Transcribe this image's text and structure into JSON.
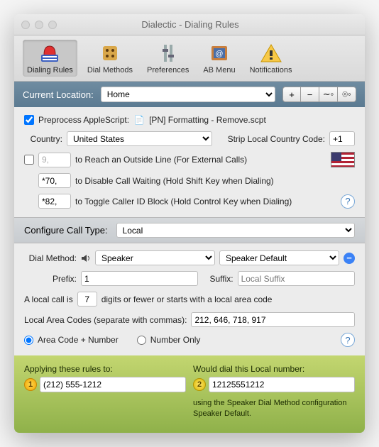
{
  "window": {
    "title": "Dialectic - Dialing Rules"
  },
  "toolbar": {
    "t0": "Dialing Rules",
    "t1": "Dial Methods",
    "t2": "Preferences",
    "t3": "AB Menu",
    "t4": "Notifications"
  },
  "location": {
    "label": "Current Location:",
    "value": "Home",
    "plus": "+",
    "minus": "−",
    "gear1": "∼◦",
    "gear2": "⌾◦"
  },
  "pre": {
    "checkLabel": "Preprocess AppleScript:",
    "script": "[PN] Formatting - Remove.scpt",
    "countryLabel": "Country:",
    "country": "United States",
    "stripLabel": "Strip Local Country Code:",
    "stripValue": "+1",
    "outsideValue": "9,",
    "outsideLabel": "to Reach an Outside Line (For External Calls)",
    "cwValue": "*70,",
    "cwLabel": "to Disable Call Waiting (Hold Shift Key when Dialing)",
    "cidValue": "*82,",
    "cidLabel": "to Toggle Caller ID Block (Hold Control Key when Dialing)"
  },
  "callType": {
    "label": "Configure Call Type:",
    "value": "Local"
  },
  "local": {
    "dmLabel": "Dial Method:",
    "dmValue": "Speaker",
    "dmSetting": "Speaker Default",
    "prefixLabel": "Prefix:",
    "prefixValue": "1",
    "suffixLabel": "Suffix:",
    "suffixPlaceholder": "Local Suffix",
    "sent1": "A local call is",
    "digits": "7",
    "sent2": "digits or fewer or starts with a local area code",
    "lacLabel": "Local Area Codes (separate with commas):",
    "lacValue": "212, 646, 718, 917",
    "r1": "Area Code + Number",
    "r2": "Number Only"
  },
  "apply": {
    "h1": "Applying these rules to:",
    "h2": "Would dial this Local number:",
    "in": "(212) 555-1212",
    "out": "12125551212",
    "note1": "using the Speaker Dial Method configuration",
    "note2": "Speaker Default."
  }
}
